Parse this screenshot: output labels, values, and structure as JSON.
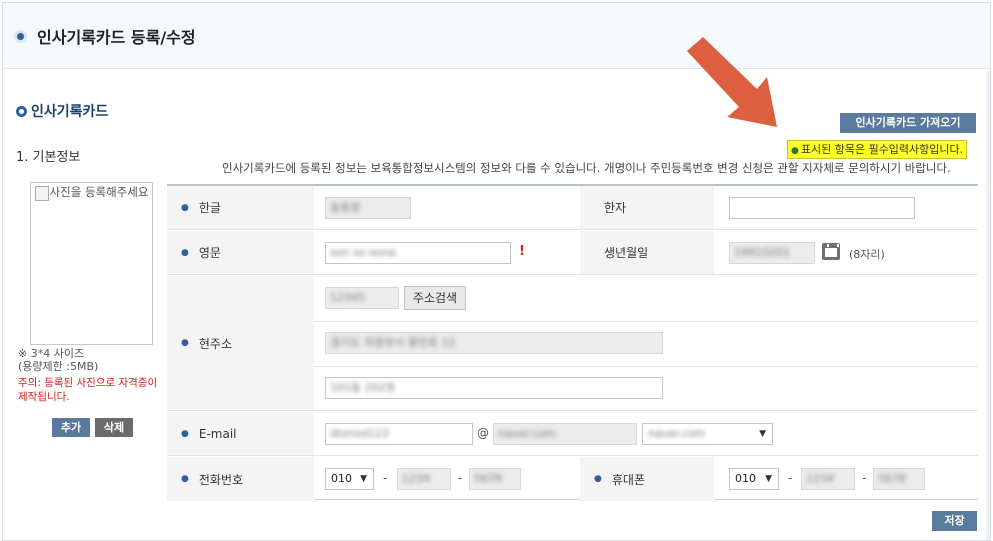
{
  "page": {
    "title": "인사기록카드 등록/수정",
    "section_title": "인사기록카드",
    "subsection": "1. 기본정보",
    "fetch_button": "인사기록카드 가져오기",
    "required_note": "표시된 항목은 필수입력사항입니다.",
    "info_text": "인사기록카드에 등록된 정보는 보육통합정보시스템의 정보와 다를 수 있습니다. 개명이나 주민등록번호 변경 신청은 관할 지자체로 문의하시기 바랍니다.",
    "save_button": "저장"
  },
  "photo": {
    "alt_text": "사진을 등록해주세요",
    "size_note": "※ 3*4 사이즈",
    "limit_note": "(용량제한 :5MB)",
    "warning": "주의: 등록된 사진으로 자격증이 제작됩니다.",
    "add_button": "추가",
    "delete_button": "삭제"
  },
  "form": {
    "korean_name": {
      "label": "한글",
      "value": "송효정"
    },
    "hanja": {
      "label": "한자",
      "value": ""
    },
    "english_name": {
      "label": "영문",
      "value": "son so eona",
      "required_mark": "!"
    },
    "birth": {
      "label": "생년월일",
      "value": "19910201",
      "hint": "(8자리)"
    },
    "address": {
      "label": "현주소",
      "zipcode": "12345",
      "search_button": "주소검색",
      "line1": "경기도 의정부시 용민로 12",
      "line2": "101동 202호"
    },
    "email": {
      "label": "E-mail",
      "local": "dtsnod123",
      "at": "@",
      "domain": "naver.com",
      "domain_select": "naver.com"
    },
    "phone": {
      "label": "전화번호",
      "area": "010",
      "mid": "1234",
      "last": "5678",
      "dash": "-"
    },
    "mobile": {
      "label": "휴대폰",
      "area": "010",
      "mid": "1234",
      "last": "5678",
      "dash": "-"
    }
  },
  "colors": {
    "accent": "#2f5f9e",
    "button": "#5a7a9e",
    "required": "#ffff2a",
    "arrow": "#dc5f40"
  },
  "icons": {
    "calendar": "calendar-icon",
    "arrow": "arrow-down-right-icon"
  }
}
